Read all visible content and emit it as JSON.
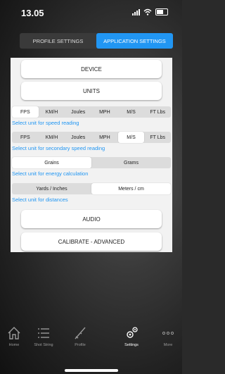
{
  "status": {
    "time": "13.05"
  },
  "tabs": [
    {
      "label": "PROFILE SETTINGS"
    },
    {
      "label": "APPLICATION SETTINGS"
    }
  ],
  "buttons": {
    "device": "DEVICE",
    "units": "UNITS",
    "audio": "AUDIO",
    "calibrate": "CALIBRATE - ADVANCED"
  },
  "speed_units": [
    "FPS",
    "KM/H",
    "Joules",
    "MPH",
    "M/S",
    "FT Lbs"
  ],
  "speed_caption": "Select unit for speed reading",
  "secondary_units": [
    "FPS",
    "KM/H",
    "Joules",
    "MPH",
    "M/S",
    "FT Lbs"
  ],
  "secondary_caption": "Select unit for secondary speed reading",
  "energy_units": [
    "Grains",
    "Grams"
  ],
  "energy_caption": "Select unit for energy calculation",
  "distance_units": [
    "Yards / Inches",
    "Meters / cm"
  ],
  "distance_caption": "Select unit for distances",
  "nav": [
    {
      "label": "Home",
      "icon": "home-icon"
    },
    {
      "label": "Shot String",
      "icon": "list-icon"
    },
    {
      "label": "Profile",
      "icon": "rifle-icon"
    },
    {
      "label": "Settings",
      "icon": "gears-icon"
    },
    {
      "label": "More",
      "icon": "more-icon"
    }
  ],
  "colors": {
    "accent": "#2196f3",
    "panel": "#f2f2f2"
  }
}
